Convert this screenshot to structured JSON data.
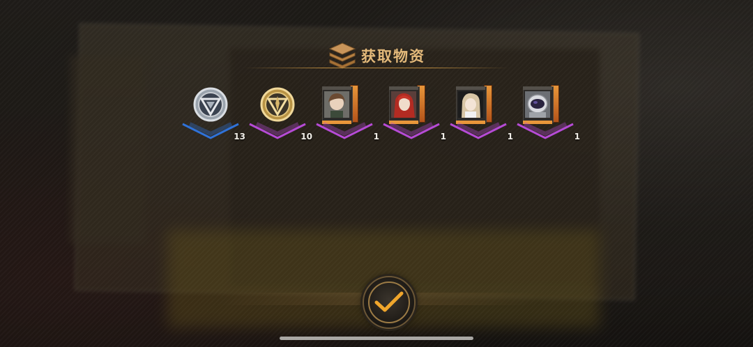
{
  "dialog": {
    "title": "获取物资",
    "icon": "stacked-supplies-icon",
    "accent_color": "#e3b97a"
  },
  "rewards": [
    {
      "name": "silver-emblem-coin",
      "icon": "silver-emblem-icon",
      "rarity_color": "#2f72d8",
      "count": "13"
    },
    {
      "name": "gold-emblem-coin",
      "icon": "gold-emblem-icon",
      "rarity_color": "#b64bd6",
      "count": "10"
    },
    {
      "name": "character-card-brown-hair",
      "icon": "character-portrait-icon",
      "rarity_color": "#b64bd6",
      "count": "1"
    },
    {
      "name": "character-card-red-hair",
      "icon": "character-portrait-icon",
      "rarity_color": "#b64bd6",
      "count": "1"
    },
    {
      "name": "character-card-blonde-hair",
      "icon": "character-portrait-icon",
      "rarity_color": "#b64bd6",
      "count": "1"
    },
    {
      "name": "character-card-helmet",
      "icon": "character-portrait-icon",
      "rarity_color": "#b64bd6",
      "count": "1"
    }
  ],
  "confirm": {
    "icon": "checkmark-icon"
  }
}
